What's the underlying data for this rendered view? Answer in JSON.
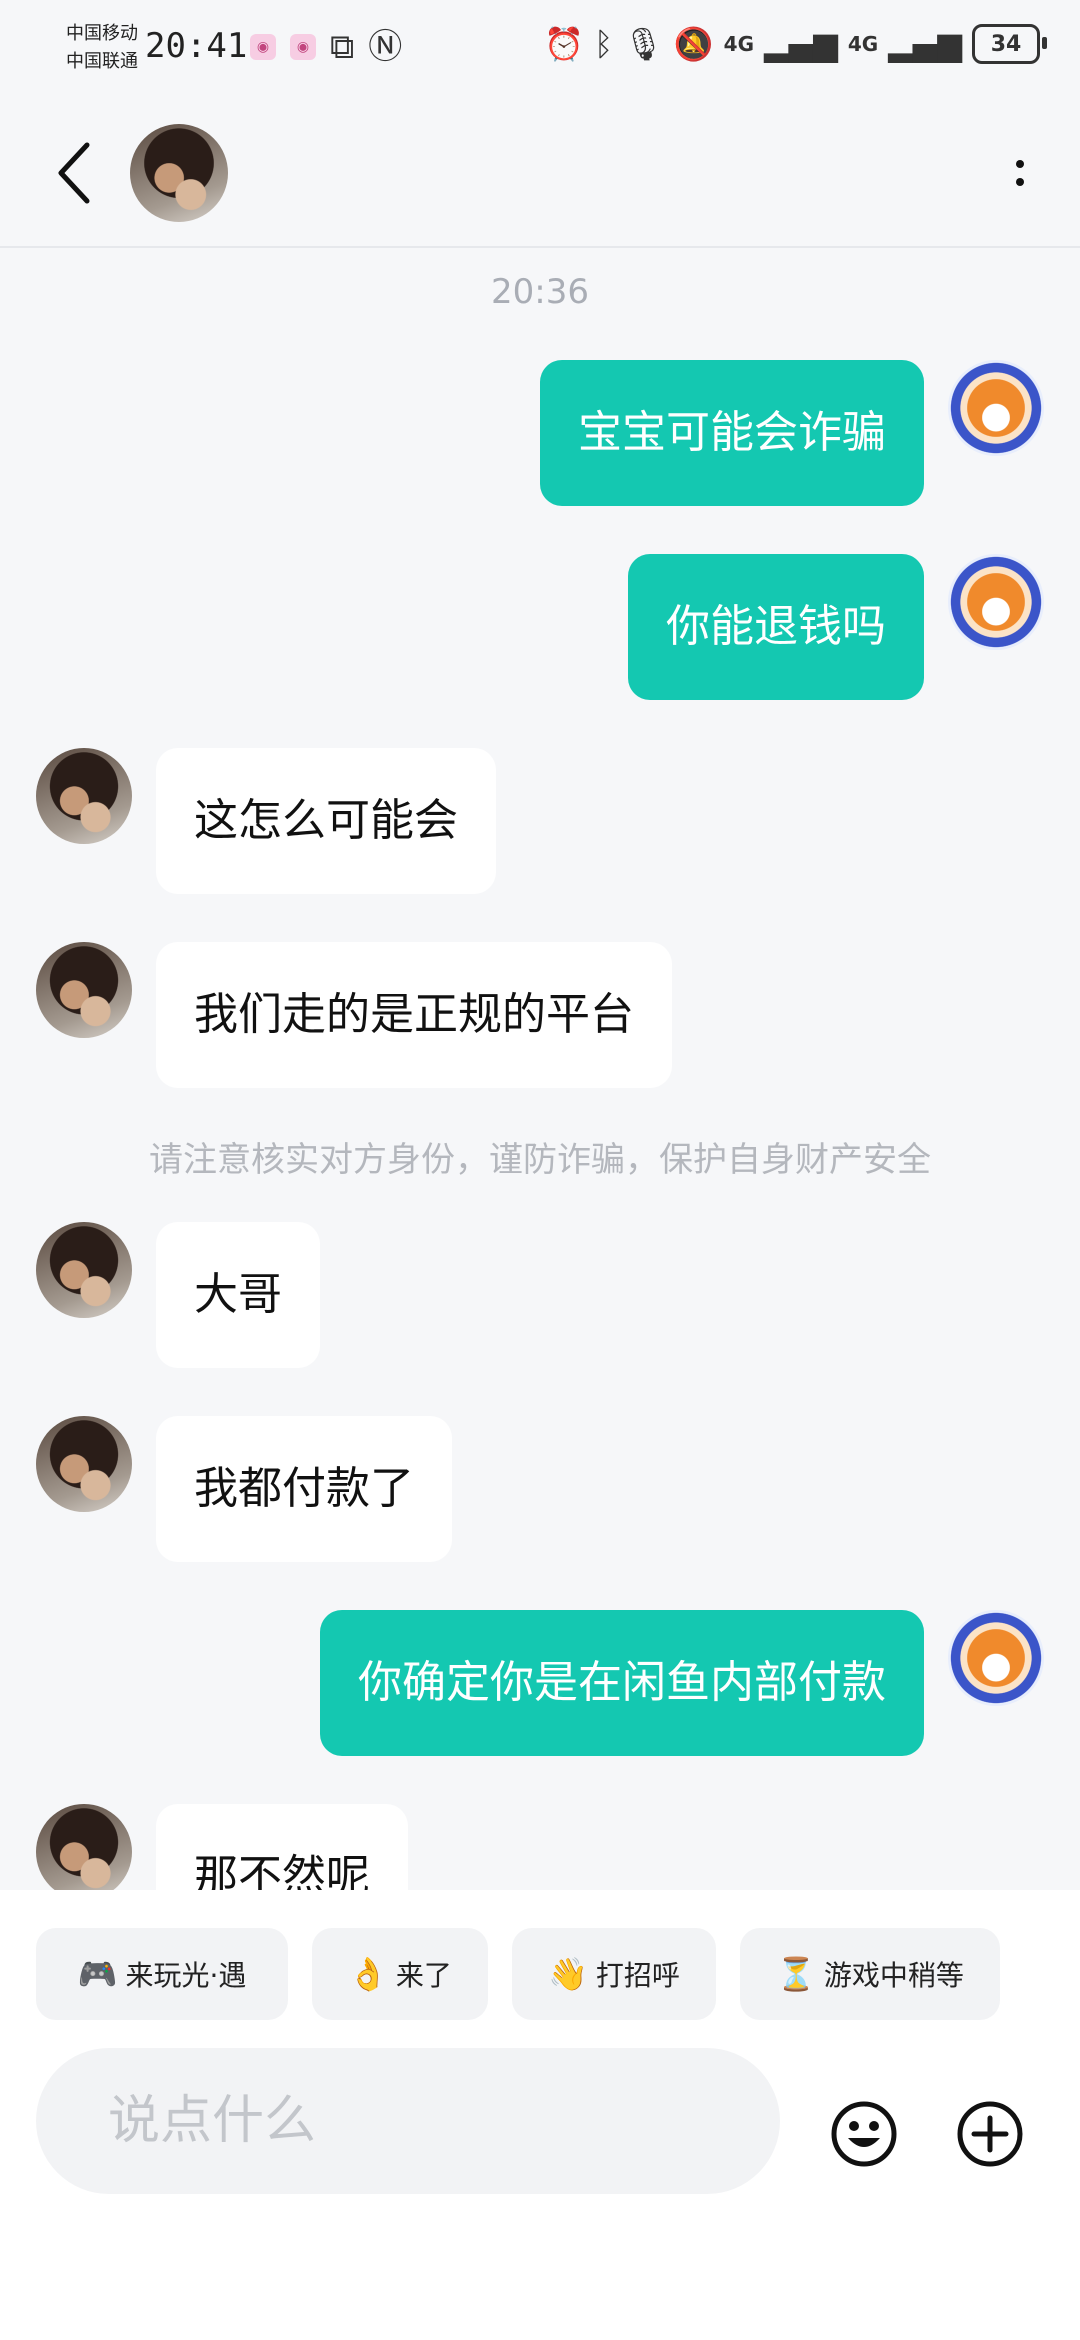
{
  "status_bar": {
    "carrier_1": "中国移动",
    "carrier_2": "中国联通",
    "time": "20:41",
    "network_1": "4G",
    "network_2": "4G",
    "battery": "34"
  },
  "header": {
    "back_icon": "chevron-left-icon",
    "more_icon": "more-vertical-icon"
  },
  "chat": {
    "timestamp": "20:36",
    "messages": [
      {
        "side": "out",
        "text": "宝宝可能会诈骗"
      },
      {
        "side": "out",
        "text": "你能退钱吗"
      },
      {
        "side": "in",
        "text": "这怎么可能会"
      },
      {
        "side": "in",
        "text": "我们走的是正规的平台"
      },
      {
        "side": "in",
        "text": "大哥"
      },
      {
        "side": "in",
        "text": "我都付款了"
      },
      {
        "side": "out",
        "text": "你确定你是在闲鱼内部付款"
      },
      {
        "side": "in",
        "text": "那不然呢"
      }
    ],
    "safety_notice": "请注意核实对方身份，谨防诈骗，保护自身财产安全"
  },
  "quick_replies": [
    {
      "emoji": "🎮",
      "label": "来玩光·遇"
    },
    {
      "emoji": "👌",
      "label": "来了"
    },
    {
      "emoji": "👋",
      "label": "打招呼"
    },
    {
      "emoji": "⏳",
      "label": "游戏中稍等"
    }
  ],
  "input": {
    "placeholder": "说点什么",
    "emoji_icon": "smiley-icon",
    "add_icon": "plus-circle-icon"
  },
  "colors": {
    "outgoing_bubble": "#14c8b1",
    "incoming_bubble": "#ffffff",
    "background": "#f6f7f9"
  }
}
